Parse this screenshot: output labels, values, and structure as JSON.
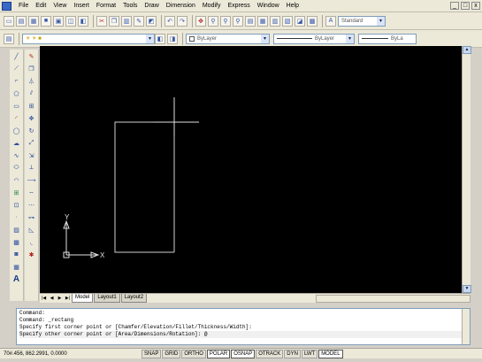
{
  "menu": {
    "items": [
      "File",
      "Edit",
      "View",
      "Insert",
      "Format",
      "Tools",
      "Draw",
      "Dimension",
      "Modify",
      "Express",
      "Window",
      "Help"
    ]
  },
  "window_controls": {
    "minimize": "_",
    "restore": "□",
    "close": "x"
  },
  "toolbar": {
    "text_style": "Standard",
    "layer": "ByLayer",
    "linetype": "ByLayer",
    "lineweight": "ByLayer",
    "color": "ByLa"
  },
  "tabs": [
    "Model",
    "Layout1",
    "Layout2"
  ],
  "active_tab": "Model",
  "command": {
    "lines": [
      "Command:",
      "Command: _rectang",
      "Specify first corner point or [Chamfer/Elevation/Fillet/Thickness/Width]:",
      "Specify other corner point or [Area/Dimensions/Rotation]: @"
    ]
  },
  "ucs": {
    "y_label": "Y",
    "x_label": "X"
  },
  "status": {
    "coords": "70#.456, 862.2991, 0.0000",
    "toggles": [
      {
        "label": "SNAP",
        "on": false
      },
      {
        "label": "GRID",
        "on": false
      },
      {
        "label": "ORTHO",
        "on": false
      },
      {
        "label": "POLAR",
        "on": true
      },
      {
        "label": "OSNAP",
        "on": true
      },
      {
        "label": "OTRACK",
        "on": false
      },
      {
        "label": "DYN",
        "on": false
      },
      {
        "label": "LWT",
        "on": false
      },
      {
        "label": "MODEL",
        "on": true
      }
    ]
  }
}
